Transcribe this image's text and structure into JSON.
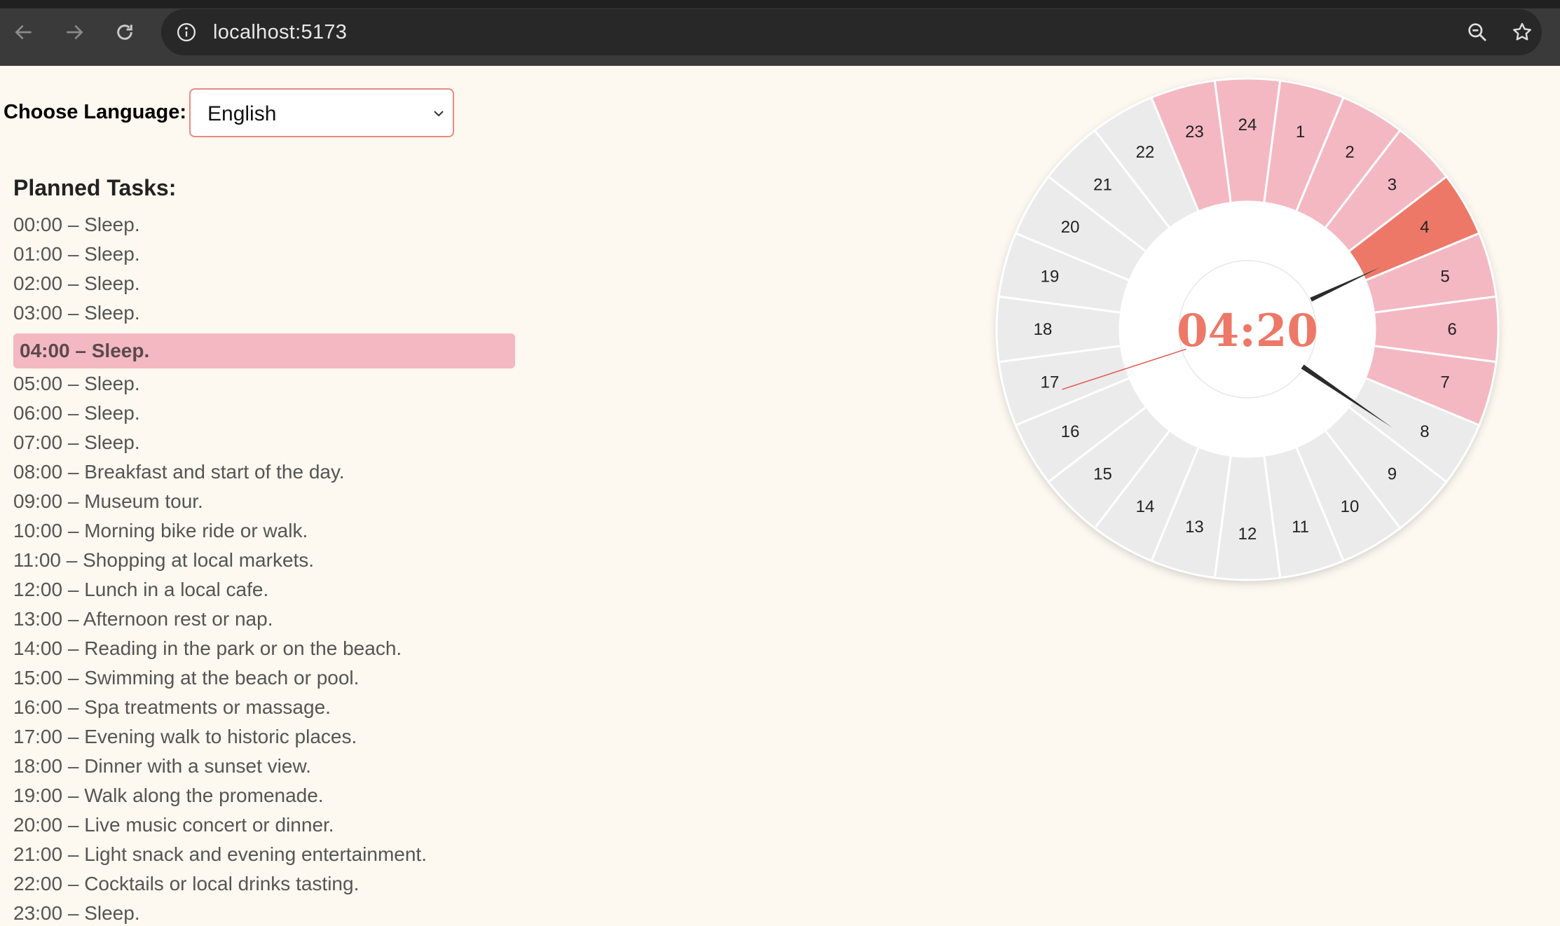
{
  "browser": {
    "url": "localhost:5173",
    "icons": {
      "back": "back-arrow-icon",
      "forward": "forward-arrow-icon",
      "reload": "reload-icon",
      "info": "info-icon",
      "zoom": "zoom-icon",
      "bookmark": "star-icon"
    }
  },
  "language": {
    "label": "Choose Language:",
    "selected": "English"
  },
  "tasks": {
    "title": "Planned Tasks:",
    "current_index": 4,
    "items": [
      "00:00 – Sleep.",
      "01:00 – Sleep.",
      "02:00 – Sleep.",
      "03:00 – Sleep.",
      "04:00 – Sleep.",
      "05:00 – Sleep.",
      "06:00 – Sleep.",
      "07:00 – Sleep.",
      "08:00 – Breakfast and start of the day.",
      "09:00 – Museum tour.",
      "10:00 – Morning bike ride or walk.",
      "11:00 – Shopping at local markets.",
      "12:00 – Lunch in a local cafe.",
      "13:00 – Afternoon rest or nap.",
      "14:00 – Reading in the park or on the beach.",
      "15:00 – Swimming at the beach or pool.",
      "16:00 – Spa treatments or massage.",
      "17:00 – Evening walk to historic places.",
      "18:00 – Dinner with a sunset view.",
      "19:00 – Walk along the promenade.",
      "20:00 – Live music concert or dinner.",
      "21:00 – Light snack and evening entertainment.",
      "22:00 – Cocktails or local drinks tasting.",
      "23:00 – Sleep."
    ]
  },
  "clock": {
    "time": "04:20",
    "hour": 4,
    "minute": 20,
    "second": 42,
    "hour_labels": [
      "24",
      "1",
      "2",
      "3",
      "4",
      "5",
      "6",
      "7",
      "8",
      "9",
      "10",
      "11",
      "12",
      "13",
      "14",
      "15",
      "16",
      "17",
      "18",
      "19",
      "20",
      "21",
      "22",
      "23"
    ],
    "sleep_hours": [
      23,
      24,
      1,
      2,
      3,
      4,
      5,
      6,
      7
    ],
    "current_hour_label": 4,
    "colors": {
      "sleep": "#f4b8c3",
      "current": "#ed7868",
      "other": "#ebebeb",
      "time_text": "#ed7868",
      "hands": "#2b2b2b",
      "second_hand": "#e35a52"
    }
  }
}
